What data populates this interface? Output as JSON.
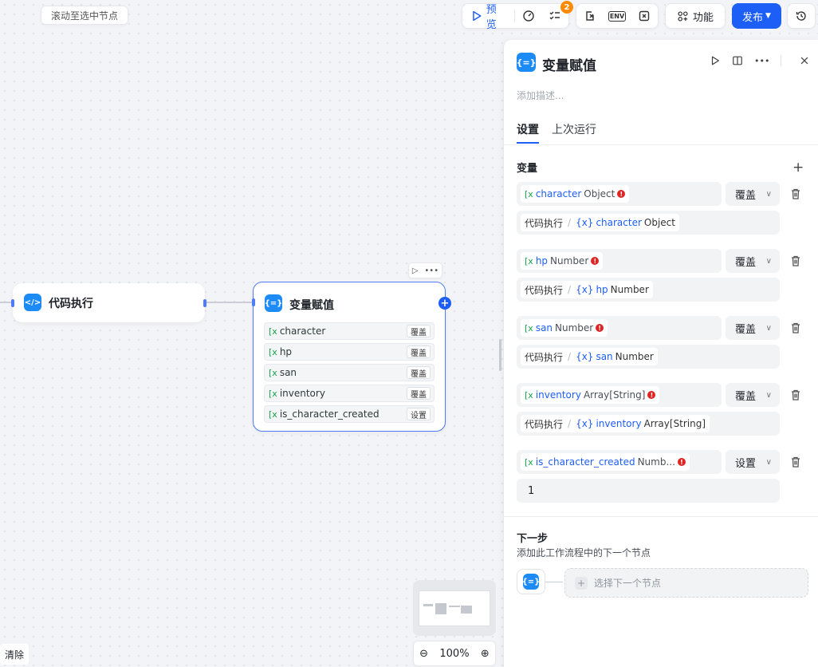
{
  "canvas": {
    "scroll_to_selected_label": "滚动至选中节点",
    "clear_label": "清除",
    "zoom_level": "100%"
  },
  "toolbar": {
    "preview_label": "预览",
    "todo_badge_count": "2",
    "env_label": "ENV",
    "features_label": "功能",
    "publish_label": "发布"
  },
  "nodes": {
    "code_node": {
      "title": "代码执行"
    },
    "assign_node": {
      "title": "变量赋值",
      "rows": [
        {
          "name": "character",
          "mode": "覆盖"
        },
        {
          "name": "hp",
          "mode": "覆盖"
        },
        {
          "name": "san",
          "mode": "覆盖"
        },
        {
          "name": "inventory",
          "mode": "覆盖"
        },
        {
          "name": "is_character_created",
          "mode": "设置"
        }
      ]
    }
  },
  "panel": {
    "title": "变量赋值",
    "description_placeholder": "添加描述...",
    "tabs": [
      "设置",
      "上次运行"
    ],
    "variables_label": "变量",
    "variables": [
      {
        "name": "character",
        "type": "Object",
        "mode": "覆盖",
        "source_node": "代码执行",
        "source_var": "character",
        "source_type": "Object"
      },
      {
        "name": "hp",
        "type": "Number",
        "mode": "覆盖",
        "source_node": "代码执行",
        "source_var": "hp",
        "source_type": "Number"
      },
      {
        "name": "san",
        "type": "Number",
        "mode": "覆盖",
        "source_node": "代码执行",
        "source_var": "san",
        "source_type": "Number"
      },
      {
        "name": "inventory",
        "type": "Array[String]",
        "mode": "覆盖",
        "source_node": "代码执行",
        "source_var": "inventory",
        "source_type": "Array[String]"
      },
      {
        "name": "is_character_created",
        "type": "Numb...",
        "mode": "设置",
        "value": "1"
      }
    ],
    "next_step": {
      "title": "下一步",
      "subtitle": "添加此工作流程中的下一个节点",
      "select_placeholder": "选择下一个节点"
    }
  },
  "colors": {
    "accent": "#1d5ef7",
    "node_icon": "#1d8bf5",
    "error": "#e02424",
    "badge": "#ff8a00",
    "var_icon": "#17a34a"
  }
}
